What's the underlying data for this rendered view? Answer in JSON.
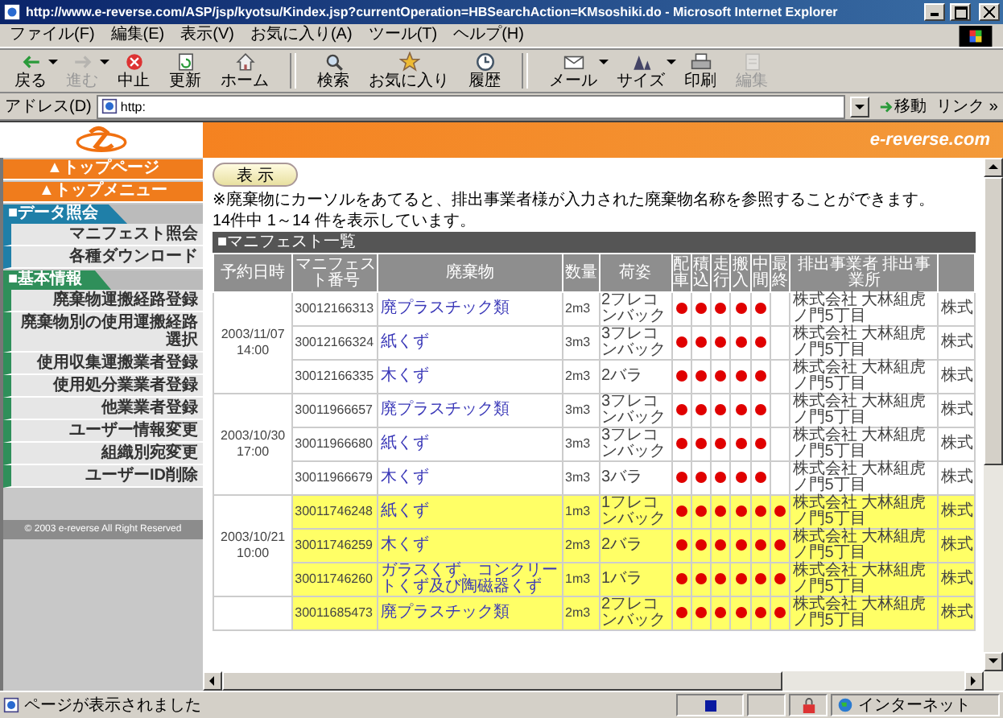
{
  "window": {
    "title": "http://www.e-reverse.com/ASP/jsp/kyotsu/Kindex.jsp?currentOperation=HBSearchAction=KMsoshiki.do - Microsoft Internet Explorer"
  },
  "menu": [
    "ファイル(F)",
    "編集(E)",
    "表示(V)",
    "お気に入り(A)",
    "ツール(T)",
    "ヘルプ(H)"
  ],
  "toolbar": [
    {
      "label": "戻る",
      "disabled": false,
      "dropdown": true
    },
    {
      "label": "進む",
      "disabled": true,
      "dropdown": true
    },
    {
      "label": "中止",
      "disabled": false,
      "dropdown": false
    },
    {
      "label": "更新",
      "disabled": false,
      "dropdown": false
    },
    {
      "label": "ホーム",
      "disabled": false,
      "dropdown": false
    },
    {
      "label": "検索",
      "disabled": false,
      "dropdown": false
    },
    {
      "label": "お気に入り",
      "disabled": false,
      "dropdown": false
    },
    {
      "label": "履歴",
      "disabled": false,
      "dropdown": false
    },
    {
      "label": "メール",
      "disabled": false,
      "dropdown": true
    },
    {
      "label": "サイズ",
      "disabled": false,
      "dropdown": true
    },
    {
      "label": "印刷",
      "disabled": false,
      "dropdown": false
    },
    {
      "label": "編集",
      "disabled": true,
      "dropdown": false
    }
  ],
  "address": {
    "label": "アドレス(D)",
    "value": "http:",
    "go": "移動",
    "links": "リンク »"
  },
  "banner": {
    "site": "e-reverse.com"
  },
  "sidebar": {
    "nav_buttons": [
      "▲トップページ",
      "▲トップメニュー"
    ],
    "sections": [
      {
        "title": "■データ照会",
        "color": "#1f7fa8",
        "items": [
          "マニフェスト照会",
          "各種ダウンロード"
        ]
      },
      {
        "title": "■基本情報",
        "color": "#2f8f5a",
        "items": [
          "廃棄物運搬経路登録",
          "廃棄物別の使用運搬経路選択",
          "使用収集運搬業者登録",
          "使用処分業業者登録",
          "他業業者登録",
          "ユーザー情報変更",
          "組織別宛変更",
          "ユーザーID削除"
        ]
      }
    ],
    "copyright": "© 2003 e-reverse All Right Reserved"
  },
  "content": {
    "show_button": "表 示",
    "note": "※廃棄物にカーソルをあてると、排出事業者様が入力された廃棄物名称を参照することができます。",
    "count": "14件中 1～14 件を表示しています。"
  },
  "table": {
    "title": "■マニフェスト一覧",
    "columns": [
      "予約日時",
      "マニフェスト番号",
      "廃棄物",
      "数量",
      "荷姿",
      "配車",
      "積込",
      "走行",
      "搬入",
      "中間",
      "最終",
      "排出事業者 排出事業所"
    ],
    "groups": [
      {
        "date": "2003/11/07",
        "time": "14:00",
        "highlighted": false,
        "rows": [
          {
            "manifest": "30012166313",
            "waste": "廃プラスチック類",
            "quantity": "2m3",
            "packing": "2フレコンバック",
            "stages": [
              true,
              true,
              true,
              true,
              true,
              false
            ],
            "discharger": "株式会社 大林組虎ノ門5丁目",
            "column_13": "株式"
          },
          {
            "manifest": "30012166324",
            "waste": "紙くず",
            "quantity": "3m3",
            "packing": "3フレコンバック",
            "stages": [
              true,
              true,
              true,
              true,
              true,
              false
            ],
            "discharger": "株式会社 大林組虎ノ門5丁目",
            "column_13": "株式"
          },
          {
            "manifest": "30012166335",
            "waste": "木くず",
            "quantity": "2m3",
            "packing": "2バラ",
            "stages": [
              true,
              true,
              true,
              true,
              true,
              false
            ],
            "discharger": "株式会社 大林組虎ノ門5丁目",
            "column_13": "株式"
          }
        ]
      },
      {
        "date": "2003/10/30",
        "time": "17:00",
        "highlighted": false,
        "rows": [
          {
            "manifest": "30011966657",
            "waste": "廃プラスチック類",
            "quantity": "3m3",
            "packing": "3フレコンバック",
            "stages": [
              true,
              true,
              true,
              true,
              true,
              false
            ],
            "discharger": "株式会社 大林組虎ノ門5丁目",
            "column_13": "株式"
          },
          {
            "manifest": "30011966680",
            "waste": "紙くず",
            "quantity": "3m3",
            "packing": "3フレコンバック",
            "stages": [
              true,
              true,
              true,
              true,
              true,
              false
            ],
            "discharger": "株式会社 大林組虎ノ門5丁目",
            "column_13": "株式"
          },
          {
            "manifest": "30011966679",
            "waste": "木くず",
            "quantity": "3m3",
            "packing": "3バラ",
            "stages": [
              true,
              true,
              true,
              true,
              true,
              false
            ],
            "discharger": "株式会社 大林組虎ノ門5丁目",
            "column_13": "株式"
          }
        ]
      },
      {
        "date": "2003/10/21",
        "time": "10:00",
        "highlighted": true,
        "rows": [
          {
            "manifest": "30011746248",
            "waste": "紙くず",
            "quantity": "1m3",
            "packing": "1フレコンバック",
            "stages": [
              true,
              true,
              true,
              true,
              true,
              true
            ],
            "discharger": "株式会社 大林組虎ノ門5丁目",
            "column_13": "株式"
          },
          {
            "manifest": "30011746259",
            "waste": "木くず",
            "quantity": "2m3",
            "packing": "2バラ",
            "stages": [
              true,
              true,
              true,
              true,
              true,
              true
            ],
            "discharger": "株式会社 大林組虎ノ門5丁目",
            "column_13": "株式"
          },
          {
            "manifest": "30011746260",
            "waste": "ガラスくず、コンクリートくず及び陶磁器くず",
            "quantity": "1m3",
            "packing": "1バラ",
            "stages": [
              true,
              true,
              true,
              true,
              true,
              true
            ],
            "discharger": "株式会社 大林組虎ノ門5丁目",
            "column_13": "株式"
          }
        ]
      },
      {
        "highlighted": true,
        "rows": [
          {
            "manifest": "30011685473",
            "waste": "廃プラスチック類",
            "quantity": "2m3",
            "packing": "2フレコンバック",
            "stages": [
              true,
              true,
              true,
              true,
              true,
              true
            ],
            "discharger": "株式会社 大林組虎ノ門5丁目",
            "column_13": "株式"
          }
        ]
      }
    ]
  },
  "status_bar": {
    "text": "ページが表示されました",
    "zone": "インターネット"
  }
}
